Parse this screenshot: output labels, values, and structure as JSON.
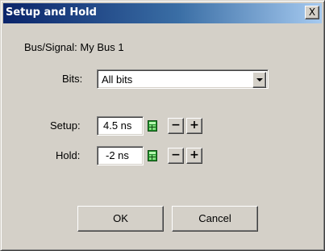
{
  "window": {
    "title": "Setup and Hold",
    "close_label": "X",
    "titlebar_colors": [
      "#0a246a",
      "#a6caf0"
    ]
  },
  "form": {
    "bus_signal_label": "Bus/Signal:",
    "bus_signal_value": "My Bus 1",
    "bits_label": "Bits:",
    "bits_value": "All bits",
    "setup_label": "Setup:",
    "setup_value": "4.5 ns",
    "hold_label": "Hold:",
    "hold_value": "-2 ns",
    "decrement_label": "−",
    "increment_label": "+"
  },
  "buttons": {
    "ok_label": "OK",
    "cancel_label": "Cancel"
  },
  "icons": {
    "calculator": "calculator-icon",
    "dropdown": "chevron-down-icon",
    "close": "close-icon"
  }
}
